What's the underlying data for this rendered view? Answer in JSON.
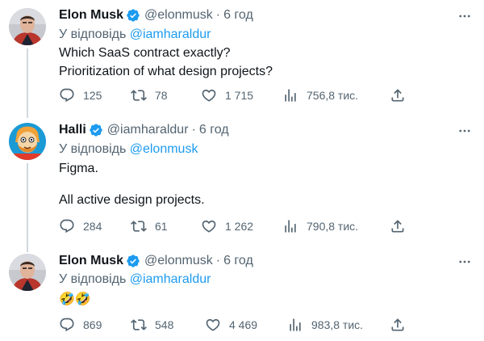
{
  "tweets": [
    {
      "name": "Elon Musk",
      "handle": "@elonmusk",
      "separator": "·",
      "time": "6 год",
      "reply_prefix": "У відповідь ",
      "reply_to": "@iamharaldur",
      "lines": [
        "Which SaaS contract exactly?",
        "Prioritization of what design projects?"
      ],
      "replies": "125",
      "retweets": "78",
      "likes": "1 715",
      "views": "756,8 тис."
    },
    {
      "name": "Halli",
      "handle": "@iamharaldur",
      "separator": "·",
      "time": "6 год",
      "reply_prefix": "У відповідь ",
      "reply_to": "@elonmusk",
      "lines": [
        "Figma.",
        "All active design projects."
      ],
      "replies": "284",
      "retweets": "61",
      "likes": "1 262",
      "views": "790,8 тис."
    },
    {
      "name": "Elon Musk",
      "handle": "@elonmusk",
      "separator": "·",
      "time": "6 год",
      "reply_prefix": "У відповідь ",
      "reply_to": "@iamharaldur",
      "lines": [
        "🤣🤣"
      ],
      "replies": "869",
      "retweets": "548",
      "likes": "4 469",
      "views": "983,8 тис."
    }
  ],
  "icons": {
    "verified": "verified-badge-icon",
    "more": "more-options-icon",
    "reply": "reply-icon",
    "retweet": "retweet-icon",
    "like": "heart-icon",
    "views": "views-chart-icon",
    "share": "share-icon"
  },
  "colors": {
    "accent": "#1d9bf0",
    "text": "#0f1419",
    "muted": "#536471",
    "thread_line": "#cfd9de"
  }
}
